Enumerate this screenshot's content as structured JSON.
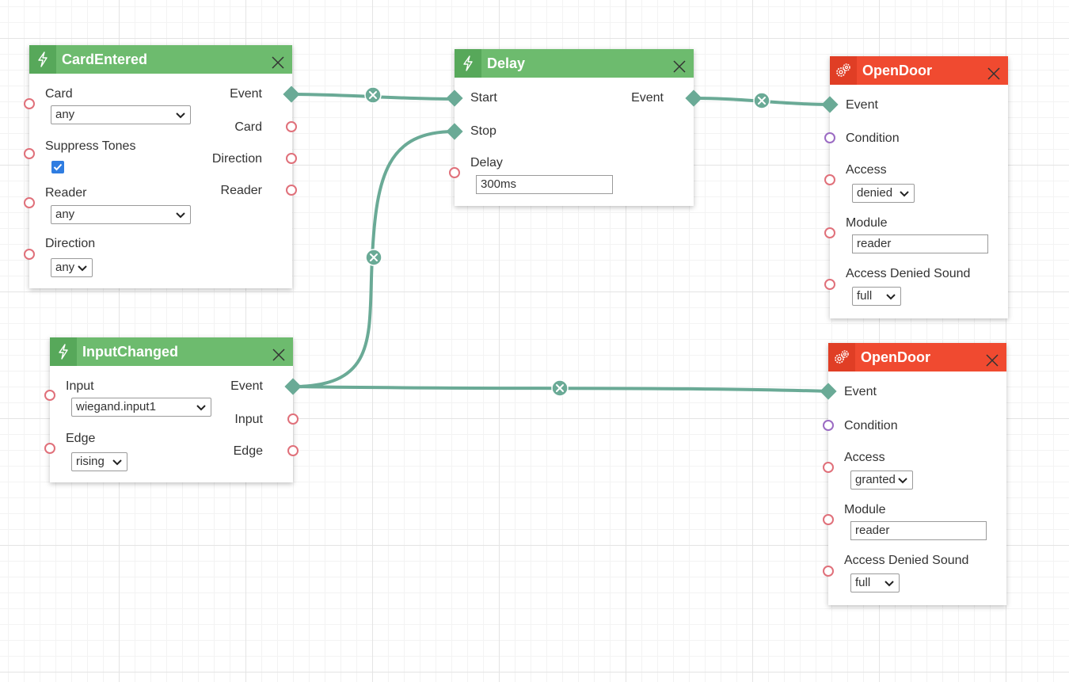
{
  "colors": {
    "trigger_header": "#6dbb6e",
    "action_header": "#f04a30",
    "wire": "#6aaa96",
    "value_port": "#e0707a",
    "condition_port": "#9b6bc3",
    "checkbox": "#2f7de1"
  },
  "nodes": {
    "card_entered": {
      "title": "CardEntered",
      "icon": "lightning-icon",
      "inputs": {
        "card": {
          "label": "Card",
          "value": "any"
        },
        "suppress_tones": {
          "label": "Suppress Tones",
          "checked": true
        },
        "reader": {
          "label": "Reader",
          "value": "any"
        },
        "direction": {
          "label": "Direction",
          "value": "any"
        }
      },
      "outputs": {
        "event": "Event",
        "card": "Card",
        "direction": "Direction",
        "reader": "Reader"
      }
    },
    "delay": {
      "title": "Delay",
      "icon": "lightning-icon",
      "inputs": {
        "start": "Start",
        "stop": "Stop",
        "delay": {
          "label": "Delay",
          "value": "300ms"
        }
      },
      "outputs": {
        "event": "Event"
      }
    },
    "input_changed": {
      "title": "InputChanged",
      "icon": "lightning-icon",
      "inputs": {
        "input": {
          "label": "Input",
          "value": "wiegand.input1"
        },
        "edge": {
          "label": "Edge",
          "value": "rising"
        }
      },
      "outputs": {
        "event": "Event",
        "input": "Input",
        "edge": "Edge"
      }
    },
    "open_door_1": {
      "title": "OpenDoor",
      "icon": "gears-icon",
      "inputs": {
        "event": "Event",
        "condition": "Condition",
        "access": {
          "label": "Access",
          "value": "denied"
        },
        "module": {
          "label": "Module",
          "value": "reader"
        },
        "sound": {
          "label": "Access Denied Sound",
          "value": "full"
        }
      }
    },
    "open_door_2": {
      "title": "OpenDoor",
      "icon": "gears-icon",
      "inputs": {
        "event": "Event",
        "condition": "Condition",
        "access": {
          "label": "Access",
          "value": "granted"
        },
        "module": {
          "label": "Module",
          "value": "reader"
        },
        "sound": {
          "label": "Access Denied Sound",
          "value": "full"
        }
      }
    }
  },
  "connections": [
    {
      "from": "CardEntered.Event",
      "to": "Delay.Start"
    },
    {
      "from": "InputChanged.Event",
      "to": "Delay.Stop"
    },
    {
      "from": "Delay.Event",
      "to": "OpenDoor.Event"
    },
    {
      "from": "InputChanged.Event",
      "to": "OpenDoor.Event"
    }
  ]
}
